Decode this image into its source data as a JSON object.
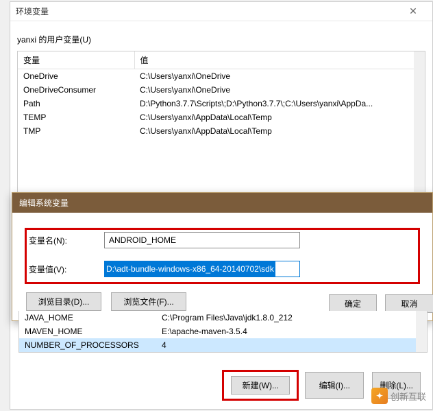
{
  "window": {
    "title": "环境变量"
  },
  "user_section": {
    "label": "yanxi 的用户变量(U)"
  },
  "columns": {
    "var": "变量",
    "val": "值"
  },
  "user_vars": [
    {
      "name": "OneDrive",
      "value": "C:\\Users\\yanxi\\OneDrive"
    },
    {
      "name": "OneDriveConsumer",
      "value": "C:\\Users\\yanxi\\OneDrive"
    },
    {
      "name": "Path",
      "value": "D:\\Python3.7.7\\Scripts\\;D:\\Python3.7.7\\;C:\\Users\\yanxi\\AppDa..."
    },
    {
      "name": "TEMP",
      "value": "C:\\Users\\yanxi\\AppData\\Local\\Temp"
    },
    {
      "name": "TMP",
      "value": "C:\\Users\\yanxi\\AppData\\Local\\Temp"
    }
  ],
  "modal": {
    "title": "编辑系统变量",
    "name_label": "变量名(N):",
    "name_value": "ANDROID_HOME",
    "value_label": "变量值(V):",
    "value_value": "D:\\adt-bundle-windows-x86_64-20140702\\sdk",
    "browse_dir": "浏览目录(D)...",
    "browse_file": "浏览文件(F)...",
    "ok": "确定",
    "cancel": "取消"
  },
  "system_vars_peek": [
    {
      "name": "JAVA_HOME",
      "value": "C:\\Program Files\\Java\\jdk1.8.0_212"
    },
    {
      "name": "MAVEN_HOME",
      "value": "E:\\apache-maven-3.5.4"
    },
    {
      "name": "NUMBER_OF_PROCESSORS",
      "value": "4"
    }
  ],
  "bottom_buttons": {
    "new": "新建(W)...",
    "edit": "编辑(I)...",
    "delete": "删除(L)..."
  },
  "watermark": "创新互联"
}
